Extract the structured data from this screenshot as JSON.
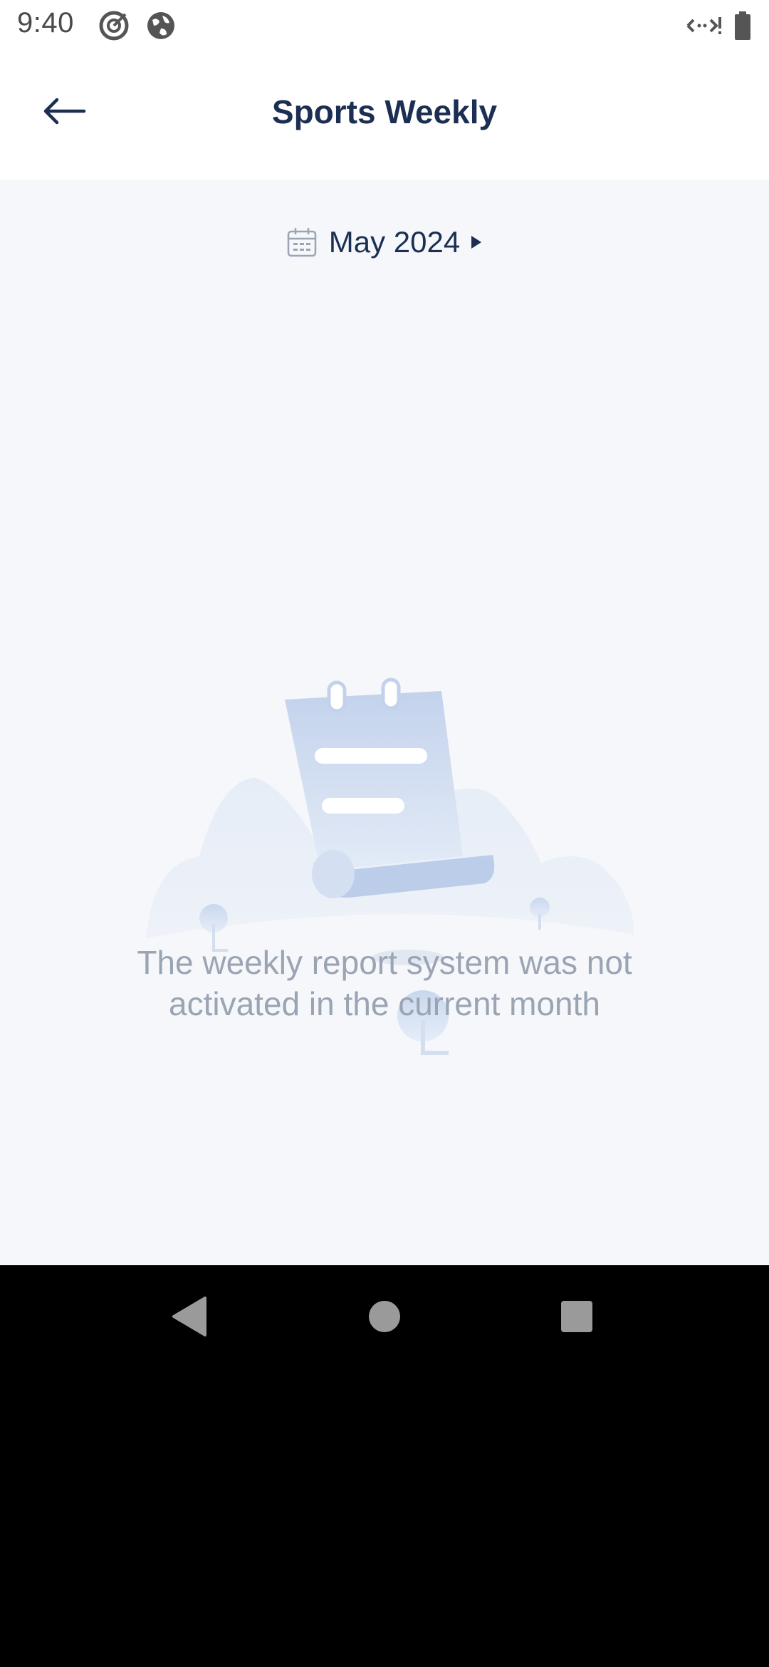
{
  "status_bar": {
    "time": "9:40",
    "icons": [
      "target-icon",
      "globe-icon",
      "data-transfer-icon",
      "battery-icon"
    ]
  },
  "header": {
    "title": "Sports Weekly",
    "back_icon": "arrow-left-icon"
  },
  "month_selector": {
    "label": "May 2024",
    "icon": "calendar-icon",
    "arrow": "triangle-right-icon"
  },
  "empty_state": {
    "message": "The weekly report system was not activated in the current month"
  },
  "nav_bar": {
    "buttons": [
      "back-nav-icon",
      "home-nav-icon",
      "recents-nav-icon"
    ]
  },
  "colors": {
    "title": "#1b2f52",
    "background": "#f5f7fa",
    "message": "#9aa4b3",
    "illustration": "#c5d4ec"
  }
}
